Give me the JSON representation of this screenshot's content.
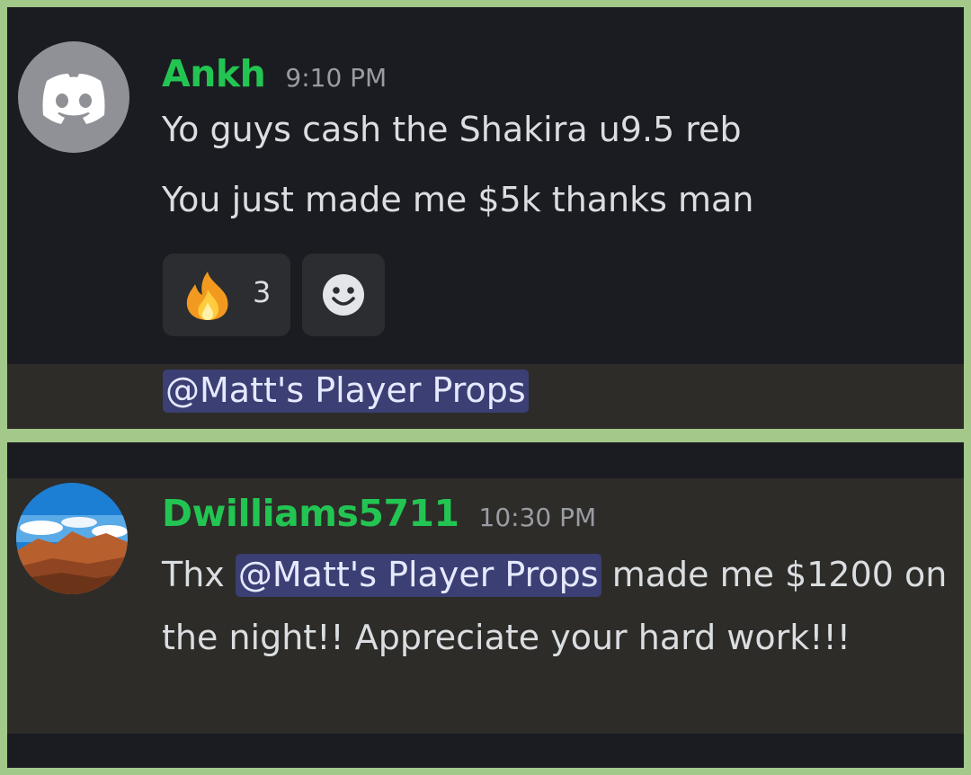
{
  "messages": [
    {
      "username": "Ankh",
      "timestamp": "9:10 PM",
      "lines": [
        "Yo guys cash the Shakira u9.5 reb",
        "You just made me $5k thanks man"
      ],
      "reactions": [
        {
          "emoji": "fire-icon",
          "count": "3"
        },
        {
          "emoji": "add-reaction-icon"
        }
      ],
      "reply_mention": "@Matt's Player Props",
      "avatar": "discord-logo-icon"
    },
    {
      "username": "Dwilliams5711",
      "timestamp": "10:30 PM",
      "text_before": "Thx ",
      "mention": "@Matt's Player Props",
      "text_after": " made me $1200 on the night!! Appreciate your hard work!!!",
      "avatar": "desert-mountain-avatar"
    }
  ],
  "colors": {
    "frame": "#a3c98a",
    "background": "#1b1c21",
    "highlight": "#2d2c29",
    "username": "#23c552",
    "mention_bg": "#3b3f73",
    "text": "#dbdee1",
    "timestamp": "#9a9ca3"
  }
}
